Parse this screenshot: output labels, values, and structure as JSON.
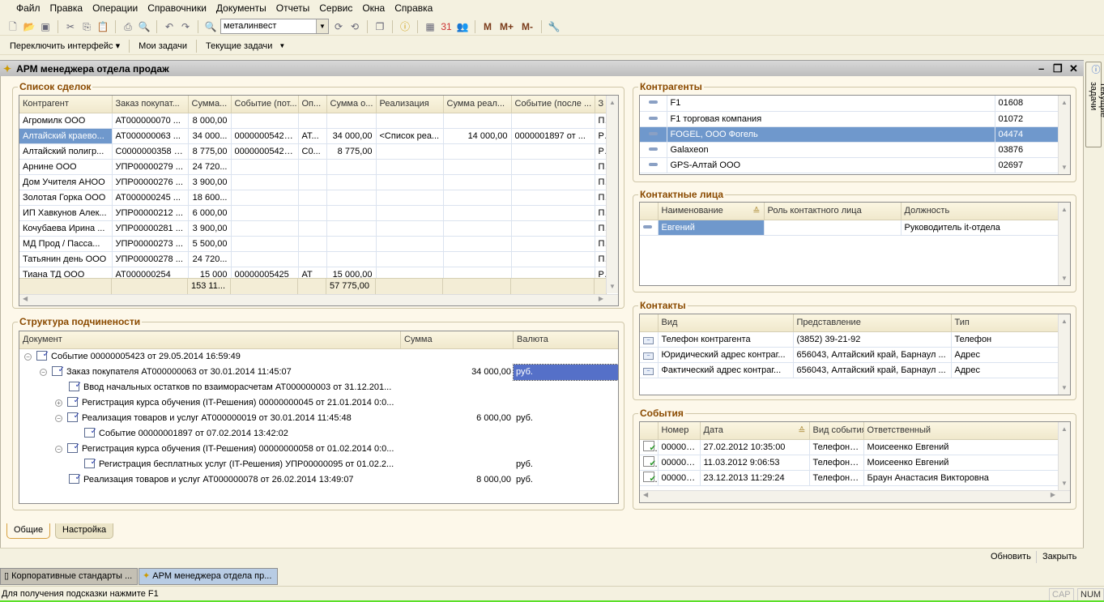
{
  "menu": [
    "Файл",
    "Правка",
    "Операции",
    "Справочники",
    "Документы",
    "Отчеты",
    "Сервис",
    "Окна",
    "Справка"
  ],
  "toolbar": {
    "search_value": "металинвест",
    "m": "M",
    "mplus": "M+",
    "mminus": "M-"
  },
  "toolbar2": {
    "switch_interface": "Переключить интерфейс",
    "my_tasks": "Мои задачи",
    "current_tasks": "Текущие задачи"
  },
  "window": {
    "title": "АРМ менеджера отдела продаж",
    "side_tab": "Текущие задачи"
  },
  "deals": {
    "caption": "Список сделок",
    "columns": [
      "Контрагент",
      "Заказ покупат...",
      "Сумма...",
      "Событие (пот...",
      "Оп...",
      "Сумма о...",
      "Реализация",
      "Сумма реал...",
      "Событие (после ...",
      "З"
    ],
    "rows": [
      [
        "Агромилк ООО",
        "АТ000000070 ...",
        "8 000,00",
        "",
        "",
        "",
        "",
        "",
        "",
        "П"
      ],
      [
        "Алтайский краево...",
        "АТ000000063 ...",
        "34 000...",
        "00000005423...",
        "АТ...",
        "34 000,00",
        "<Список реа...",
        "14 000,00",
        "0000001897 от ...",
        "Р"
      ],
      [
        "Алтайский полигр...",
        "С0000000358 о...",
        "8 775,00",
        "00000005424...",
        "С0...",
        "8 775,00",
        "",
        "",
        "",
        "Р"
      ],
      [
        "Арнине ООО",
        "УПР00000279 ...",
        "24 720...",
        "",
        "",
        "",
        "",
        "",
        "",
        "П"
      ],
      [
        "Дом Учителя АНОО",
        "УПР00000276 ...",
        "3 900,00",
        "",
        "",
        "",
        "",
        "",
        "",
        "П"
      ],
      [
        "Золотая Горка ООО",
        "АТ000000245 ...",
        "18 600...",
        "",
        "",
        "",
        "",
        "",
        "",
        "П"
      ],
      [
        "ИП Хавкунов Алек...",
        "УПР00000212 ...",
        "6 000,00",
        "",
        "",
        "",
        "",
        "",
        "",
        "П"
      ],
      [
        "Кочубаева  Ирина ...",
        "УПР00000281 ...",
        "3 900,00",
        "",
        "",
        "",
        "",
        "",
        "",
        "П"
      ],
      [
        "МД Прод / Пасса...",
        "УПР00000273 ...",
        "5 500,00",
        "",
        "",
        "",
        "",
        "",
        "",
        "П"
      ],
      [
        "Татьянин день ООО",
        "УПР00000278 ...",
        "24 720...",
        "",
        "",
        "",
        "",
        "",
        "",
        "П"
      ],
      [
        "Тиана ТД ООО",
        "АТ000000254",
        "15 000",
        "00000005425",
        "АТ",
        "15 000,00",
        "",
        "",
        "",
        "Р"
      ]
    ],
    "selected_row": 1,
    "totals": [
      "",
      "",
      "153 11...",
      "",
      "",
      "57 775,00",
      "",
      "",
      "",
      ""
    ]
  },
  "structure": {
    "caption": "Структура подчинености",
    "columns": [
      "Документ",
      "Сумма",
      "Валюта"
    ],
    "rows": [
      {
        "level": 0,
        "toggle": "−",
        "text": "Событие 00000005423 от 29.05.2014 16:59:49",
        "sum": "",
        "currency": ""
      },
      {
        "level": 1,
        "toggle": "−",
        "text": "Заказ покупателя АТ000000063 от 30.01.2014 11:45:07",
        "sum": "34 000,00",
        "currency": "руб.",
        "selected": true
      },
      {
        "level": 2,
        "toggle": "",
        "text": "Ввод начальных остатков по взаиморасчетам АТ000000003 от 31.12.201...",
        "sum": "",
        "currency": ""
      },
      {
        "level": 2,
        "toggle": "+",
        "text": "Регистрация курса обучения (IT-Решения) 00000000045 от 21.01.2014 0:0...",
        "sum": "",
        "currency": ""
      },
      {
        "level": 2,
        "toggle": "−",
        "text": "Реализация товаров и услуг АТ000000019 от 30.01.2014 11:45:48",
        "sum": "6 000,00",
        "currency": "руб."
      },
      {
        "level": 3,
        "toggle": "",
        "text": "Событие 00000001897 от 07.02.2014 13:42:02",
        "sum": "",
        "currency": ""
      },
      {
        "level": 2,
        "toggle": "−",
        "text": "Регистрация курса обучения (IT-Решения) 00000000058 от 01.02.2014 0:0...",
        "sum": "",
        "currency": ""
      },
      {
        "level": 3,
        "toggle": "",
        "text": "Регистрация бесплатных услуг (IT-Решения) УПР00000095 от 01.02.2...",
        "sum": "",
        "currency": "руб."
      },
      {
        "level": 2,
        "toggle": "",
        "text": "Реализация товаров и услуг АТ000000078 от 26.02.2014 13:49:07",
        "sum": "8 000,00",
        "currency": "руб."
      }
    ]
  },
  "counterparties": {
    "caption": "Контрагенты",
    "rows": [
      [
        "F1",
        "01608"
      ],
      [
        "F1 торговая компания",
        "01072"
      ],
      [
        "FOGEL, ООО Фогель",
        "04474"
      ],
      [
        "Galaxeon",
        "03876"
      ],
      [
        "GPS-Алтай ООО",
        "02697"
      ]
    ],
    "selected_row": 2
  },
  "contact_persons": {
    "caption": "Контактные лица",
    "columns": [
      "Наименование",
      "Роль контактного лица",
      "Должность"
    ],
    "rows": [
      [
        "Евгений",
        "",
        "Руководитель it-отдела"
      ]
    ]
  },
  "contacts": {
    "caption": "Контакты",
    "columns": [
      "Вид",
      "Представление",
      "Тип"
    ],
    "rows": [
      [
        "Телефон контрагента",
        "(3852) 39-21-92",
        "Телефон"
      ],
      [
        "Юридический адрес контраг...",
        "656043, Алтайский край, Барнаул ...",
        "Адрес"
      ],
      [
        "Фактический адрес контраг...",
        "656043, Алтайский край, Барнаул ...",
        "Адрес"
      ]
    ]
  },
  "events": {
    "caption": "События",
    "columns": [
      "Номер",
      "Дата",
      "Вид события",
      "Ответственный"
    ],
    "rows": [
      [
        "000000...",
        "27.02.2012 10:35:00",
        "Телефонн...",
        "Моисеенко Евгений"
      ],
      [
        "000000...",
        "11.03.2012 9:06:53",
        "Телефонн...",
        "Моисеенко Евгений"
      ],
      [
        "000000...",
        "23.12.2013 11:29:24",
        "Телефонн...",
        "Браун Анастасия Викторовна"
      ]
    ]
  },
  "tabs": [
    "Общие",
    "Настройка"
  ],
  "bottom": {
    "refresh": "Обновить",
    "close": "Закрыть"
  },
  "taskbar": [
    "Корпоративные стандарты ...",
    "АРМ менеджера отдела пр..."
  ],
  "status": {
    "hint": "Для получения подсказки нажмите F1",
    "cap": "CAP",
    "num": "NUM"
  },
  "colors": {
    "selection": "#6f98cc",
    "caption": "#8a4a00",
    "background": "#fdf8ea"
  }
}
